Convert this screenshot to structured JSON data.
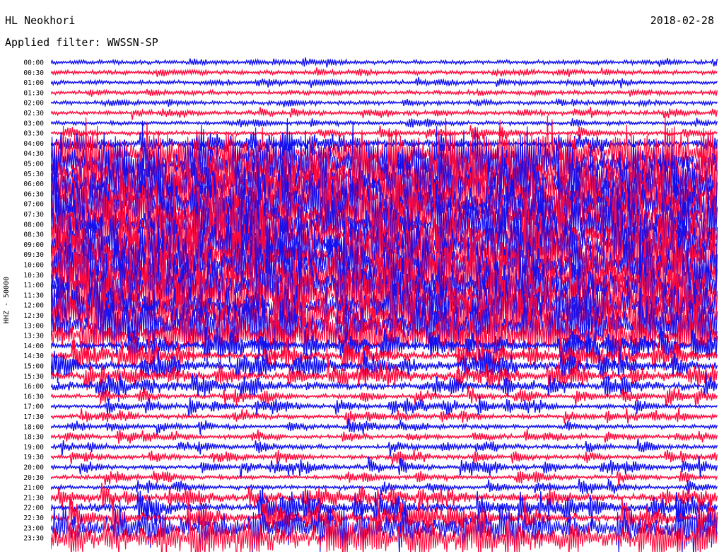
{
  "header": {
    "station": "HL Neokhori",
    "date": "2018-02-28",
    "filter_label": "Applied filter:",
    "filter_value": "WWSSN-SP"
  },
  "chart_data": {
    "type": "line",
    "title": "HL Neokhori",
    "ylabel": "HHZ - 50000",
    "subtitle": "Applied filter: WWSSN-SP",
    "trace_labels": [
      "00:00",
      "00:30",
      "01:00",
      "01:30",
      "02:00",
      "02:30",
      "03:00",
      "03:30",
      "04:00",
      "04:30",
      "05:00",
      "05:30",
      "06:00",
      "06:30",
      "07:00",
      "07:30",
      "08:00",
      "08:30",
      "09:00",
      "09:30",
      "10:00",
      "10:30",
      "11:00",
      "11:30",
      "12:00",
      "12:30",
      "13:00",
      "13:30",
      "14:00",
      "14:30",
      "15:00",
      "15:30",
      "16:00",
      "16:30",
      "17:00",
      "17:30",
      "18:00",
      "18:30",
      "19:00",
      "19:30",
      "20:00",
      "20:30",
      "21:00",
      "21:30",
      "22:00",
      "22:30",
      "23:00",
      "23:30"
    ],
    "trace_minutes": 30,
    "activity_level": [
      0.08,
      0.08,
      0.1,
      0.06,
      0.06,
      0.1,
      0.12,
      0.18,
      0.3,
      0.85,
      1,
      1,
      1,
      1,
      1,
      1,
      1,
      1,
      1,
      1,
      1,
      1,
      1,
      1,
      1,
      1,
      0.95,
      0.8,
      0.6,
      0.55,
      0.45,
      0.4,
      0.35,
      0.28,
      0.25,
      0.2,
      0.18,
      0.18,
      0.2,
      0.18,
      0.25,
      0.2,
      0.2,
      0.3,
      0.55,
      0.6,
      0.65,
      0.65
    ],
    "colors": [
      "#1010f0",
      "#ff0a3c"
    ],
    "grid": false
  }
}
